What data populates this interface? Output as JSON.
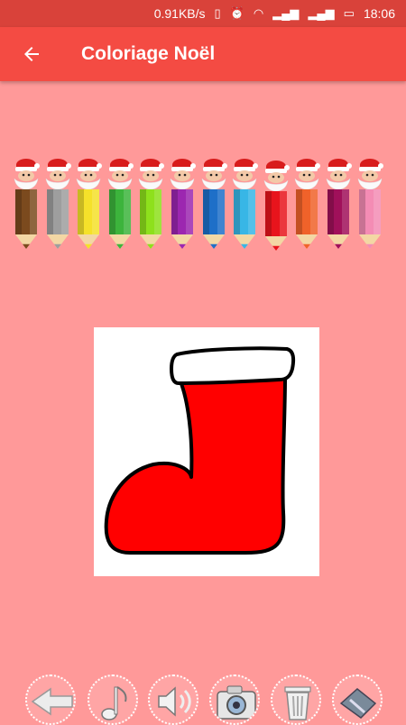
{
  "status_bar": {
    "network_speed": "0.91KB/s",
    "time": "18:06",
    "icons": [
      "vibrate-icon",
      "alarm-icon",
      "wifi-icon",
      "signal-icon",
      "signal-icon",
      "battery-icon"
    ]
  },
  "app_bar": {
    "back_icon": "arrow-left-icon",
    "title": "Coloriage Noël"
  },
  "palette": {
    "item_icon": "santa-pencil-icon",
    "colors": [
      "#7b4a1e",
      "#9e9e9e",
      "#f5e12a",
      "#3cb43c",
      "#8ee01c",
      "#9c27b0",
      "#1e6fc8",
      "#38b6e6",
      "#e8141c",
      "#f0622a",
      "#a0105a",
      "#f48cb4"
    ],
    "selected_index": 8
  },
  "drawing": {
    "subject": "christmas-stocking",
    "fill_color": "#ff0000",
    "cuff_color": "#ffffff"
  },
  "toolbar": {
    "buttons": [
      "back-arrow-icon",
      "music-note-icon",
      "speaker-icon",
      "camera-icon",
      "trash-icon",
      "eraser-icon"
    ]
  },
  "colors": {
    "status_bar": "#d9423a",
    "app_bar": "#f44b43",
    "background": "#ff9999"
  }
}
